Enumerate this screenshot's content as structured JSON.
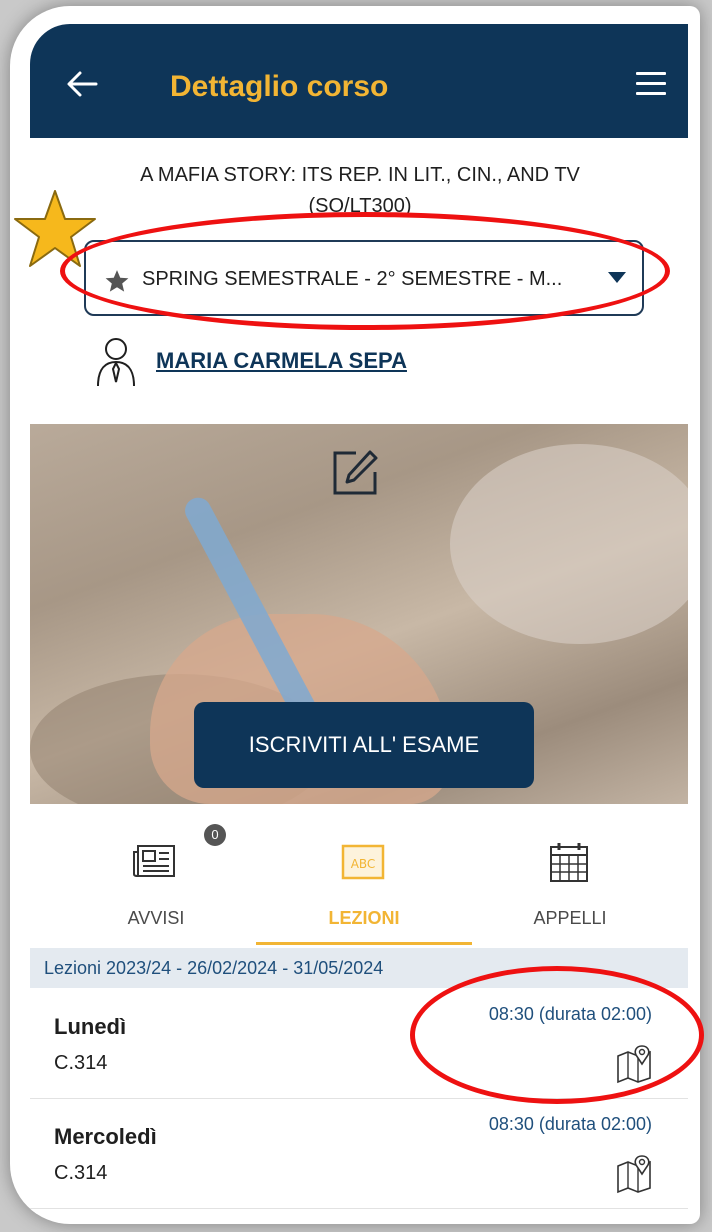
{
  "header": {
    "title": "Dettaglio corso"
  },
  "course": {
    "title_line1": "A MAFIA STORY: ITS REP. IN LIT., CIN., AND TV",
    "title_line2": "(SO/LT300)",
    "semester": "SPRING SEMESTRALE - 2° SEMESTRE - M...",
    "teacher": "MARIA CARMELA SEPA"
  },
  "banner": {
    "exam_button": "ISCRIVITI ALL' ESAME"
  },
  "tabs": [
    {
      "label": "AVVISI",
      "badge": "0",
      "icon": "newspaper-icon"
    },
    {
      "label": "LEZIONI",
      "icon": "blackboard-icon",
      "active": true
    },
    {
      "label": "APPELLI",
      "icon": "calendar-icon"
    }
  ],
  "lessons": {
    "header": "Lezioni 2023/24 - 26/02/2024 - 31/05/2024",
    "items": [
      {
        "day": "Lunedì",
        "room": "C.314",
        "time": "08:30 (durata 02:00)"
      },
      {
        "day": "Mercoledì",
        "room": "C.314",
        "time": "08:30 (durata 02:00)"
      }
    ]
  },
  "colors": {
    "primary": "#0e3558",
    "accent": "#f2b534",
    "annotation": "#ee1111"
  }
}
